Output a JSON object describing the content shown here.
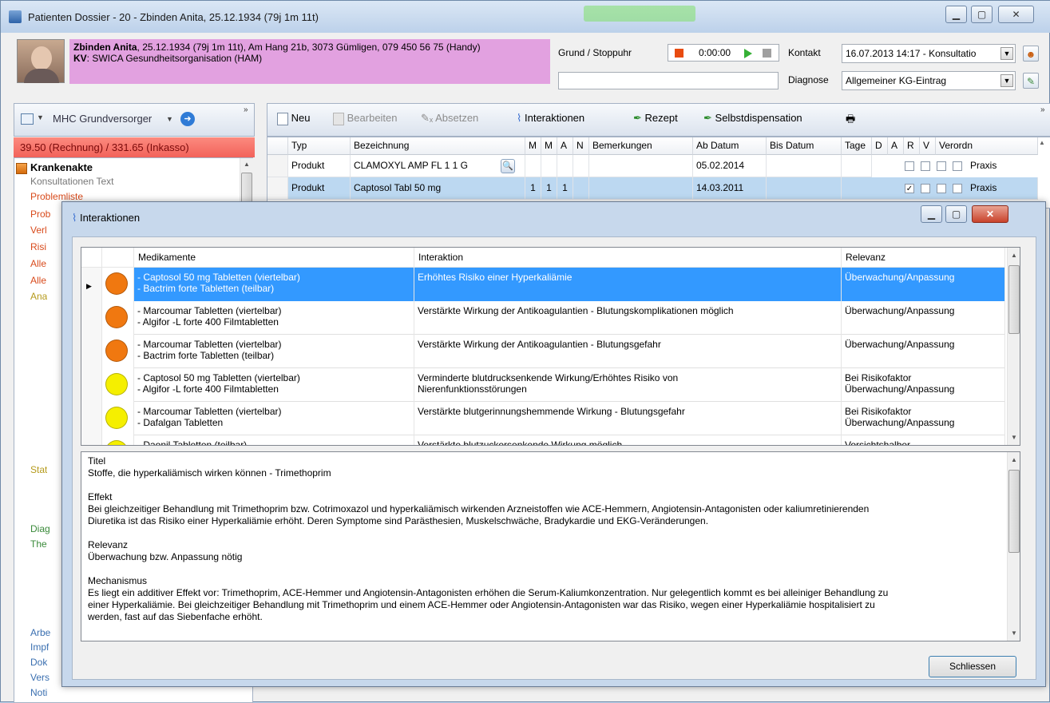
{
  "window": {
    "title": "Patienten Dossier - 20 - Zbinden Anita, 25.12.1934 (79j 1m 11t)"
  },
  "patient": {
    "name": "Zbinden Anita",
    "details": ", 25.12.1934 (79j 1m 11t), Am Hang 21b, 3073 Gümligen, 079 450 56 75 (Handy)",
    "kv_label": "KV",
    "kv_value": ": SWICA Gesundheitsorganisation (HAM)"
  },
  "header": {
    "grund_label": "Grund / Stoppuhr",
    "timer": "0:00:00",
    "kontakt_label": "Kontakt",
    "kontakt_value": "16.07.2013 14:17 - Konsultatio",
    "diagnose_label": "Diagnose",
    "diagnose_value": "Allgemeiner KG-Eintrag"
  },
  "left": {
    "toolbar_label": "MHC Grundversorger",
    "billing": "39.50 (Rechnung) / 331.65 (Inkasso)",
    "tree": [
      {
        "label": "Krankenakte"
      },
      {
        "label": "Konsultationen Text"
      },
      {
        "label": "Problemliste"
      },
      {
        "label": "Prob"
      },
      {
        "label": "Verl"
      },
      {
        "label": "Risi"
      },
      {
        "label": "Alle"
      },
      {
        "label": "Alle"
      },
      {
        "label": "Ana"
      },
      {
        "label": "Stat"
      },
      {
        "label": "Diag"
      },
      {
        "label": "The"
      },
      {
        "label": "Arbe"
      },
      {
        "label": "Impf"
      },
      {
        "label": "Dok"
      },
      {
        "label": "Vers"
      },
      {
        "label": "Noti"
      }
    ]
  },
  "toolbar": {
    "neu": "Neu",
    "bearbeiten": "Bearbeiten",
    "absetzen": "Absetzen",
    "interaktionen": "Interaktionen",
    "rezept": "Rezept",
    "selbstdispensation": "Selbstdispensation"
  },
  "medgrid": {
    "columns": [
      "Typ",
      "Bezeichnung",
      "M",
      "M",
      "A",
      "N",
      "Bemerkungen",
      "Ab Datum",
      "Bis Datum",
      "Tage",
      "D",
      "A",
      "R",
      "V",
      "Verordn"
    ],
    "rows": [
      {
        "typ": "Produkt",
        "bez": "CLAMOXYL AMP FL 1 1 G",
        "m1": "",
        "m2": "",
        "a": "",
        "n": "",
        "ab": "05.02.2014",
        "verord": "Praxis",
        "d": false
      },
      {
        "typ": "Produkt",
        "bez": "Captosol Tabl 50 mg",
        "m1": "1",
        "m2": "1",
        "a": "1",
        "n": "",
        "ab": "14.03.2011",
        "verord": "Praxis",
        "d": true
      }
    ]
  },
  "dialog": {
    "title": "Interaktionen",
    "columns": {
      "med": "Medikamente",
      "inter": "Interaktion",
      "rel": "Relevanz"
    },
    "rows": [
      {
        "color": "#f07810",
        "med1": "- Captosol 50 mg Tabletten (viertelbar)",
        "med2": "- Bactrim forte Tabletten (teilbar)",
        "inter1": "Erhöhtes Risiko einer Hyperkaliämie",
        "inter2": "",
        "rel1": "Überwachung/Anpassung",
        "rel2": ""
      },
      {
        "color": "#f07810",
        "med1": "- Marcoumar Tabletten (viertelbar)",
        "med2": "- Algifor -L forte 400 Filmtabletten",
        "inter1": "Verstärkte Wirkung der Antikoagulantien - Blutungskomplikationen möglich",
        "inter2": "",
        "rel1": "Überwachung/Anpassung",
        "rel2": ""
      },
      {
        "color": "#f07810",
        "med1": "- Marcoumar Tabletten (viertelbar)",
        "med2": "- Bactrim forte Tabletten (teilbar)",
        "inter1": "Verstärkte Wirkung der Antikoagulantien - Blutungsgefahr",
        "inter2": "",
        "rel1": "Überwachung/Anpassung",
        "rel2": ""
      },
      {
        "color": "#f5ef00",
        "med1": "- Captosol 50 mg Tabletten (viertelbar)",
        "med2": "- Algifor -L forte 400 Filmtabletten",
        "inter1": "Verminderte blutdrucksenkende Wirkung/Erhöhtes Risiko von",
        "inter2": "Nierenfunktionsstörungen",
        "rel1": "Bei Risikofaktor",
        "rel2": "Überwachung/Anpassung"
      },
      {
        "color": "#f5ef00",
        "med1": "- Marcoumar Tabletten (viertelbar)",
        "med2": "- Dafalgan Tabletten",
        "inter1": "Verstärkte blutgerinnungshemmende Wirkung - Blutungsgefahr",
        "inter2": "",
        "rel1": "Bei Risikofaktor",
        "rel2": "Überwachung/Anpassung"
      },
      {
        "color": "#f5ef00",
        "med1": "- Daonil Tabletten (teilbar)",
        "med2": "",
        "inter1": "Verstärkte blutzuckersenkende Wirkung möglich",
        "inter2": "",
        "rel1": "Vorsichtshalber",
        "rel2": ""
      }
    ],
    "detail": {
      "titel_h": "Titel",
      "titel": "Stoffe, die hyperkaliämisch wirken können - Trimethoprim",
      "effekt_h": "Effekt",
      "effekt1": "Bei gleichzeitiger Behandlung mit Trimethoprim bzw. Cotrimoxazol und hyperkaliämisch wirkenden Arzneistoffen wie ACE-Hemmern, Angiotensin-Antagonisten oder kaliumretinierenden",
      "effekt2": "Diuretika ist das Risiko einer Hyperkaliämie erhöht. Deren Symptome sind Parästhesien, Muskelschwäche, Bradykardie und EKG-Veränderungen.",
      "relevanz_h": "Relevanz",
      "relevanz": "Überwachung bzw. Anpassung nötig",
      "mech_h": "Mechanismus",
      "mech1": "Es liegt ein additiver Effekt vor: Trimethoprim, ACE-Hemmer und Angiotensin-Antagonisten erhöhen die Serum-Kaliumkonzentration. Nur gelegentlich kommt es bei alleiniger Behandlung zu",
      "mech2": "einer Hyperkaliämie. Bei gleichzeitiger Behandlung mit Trimethoprim und einem ACE-Hemmer oder Angiotensin-Antagonisten war das Risiko, wegen einer Hyperkaliämie hospitalisiert zu",
      "mech3": "werden, fast auf das Siebenfache erhöht."
    },
    "close_label": "Schliessen"
  }
}
